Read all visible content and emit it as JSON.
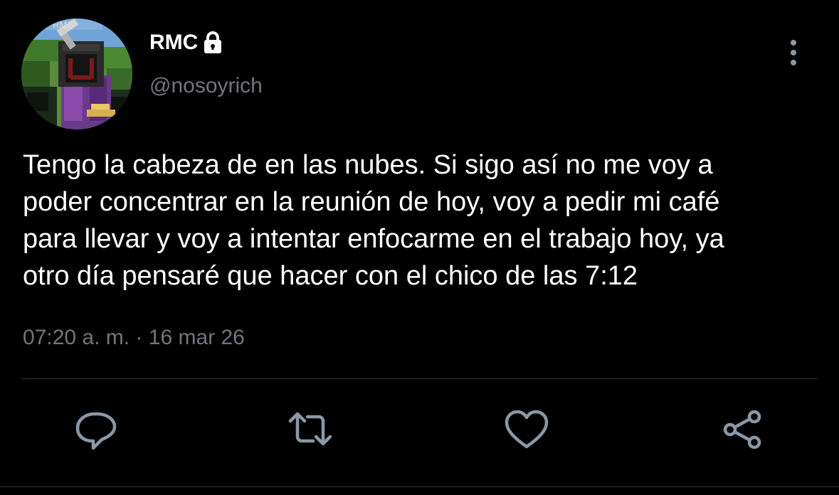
{
  "author": {
    "display_name": "RMC",
    "handle": "@nosoyrich",
    "avatar_icon": "minecraft-character-avatar",
    "avatar_tag": "RMC",
    "protected_icon": "lock-icon"
  },
  "tweet": {
    "text_lines": [
      "Tengo la cabeza de en las nubes. Si sigo así no me voy a",
      "poder concentrar en la reunión de hoy, voy a pedir mi café",
      "para llevar y voy a intentar enfocarme en el trabajo hoy, ya",
      "otro día pensaré que hacer con el chico de las 7:12"
    ],
    "time": "07:20 a. m.",
    "separator": " · ",
    "date": "16 mar 26"
  },
  "actions": {
    "reply_icon": "reply-icon",
    "retweet_icon": "retweet-icon",
    "like_icon": "heart-icon",
    "share_icon": "share-icon",
    "more_icon": "more-vertical-icon"
  },
  "colors": {
    "background": "#000000",
    "text_primary": "#ffffff",
    "text_secondary": "#71767b",
    "icon": "#8b98a5",
    "divider": "#2f3336"
  }
}
